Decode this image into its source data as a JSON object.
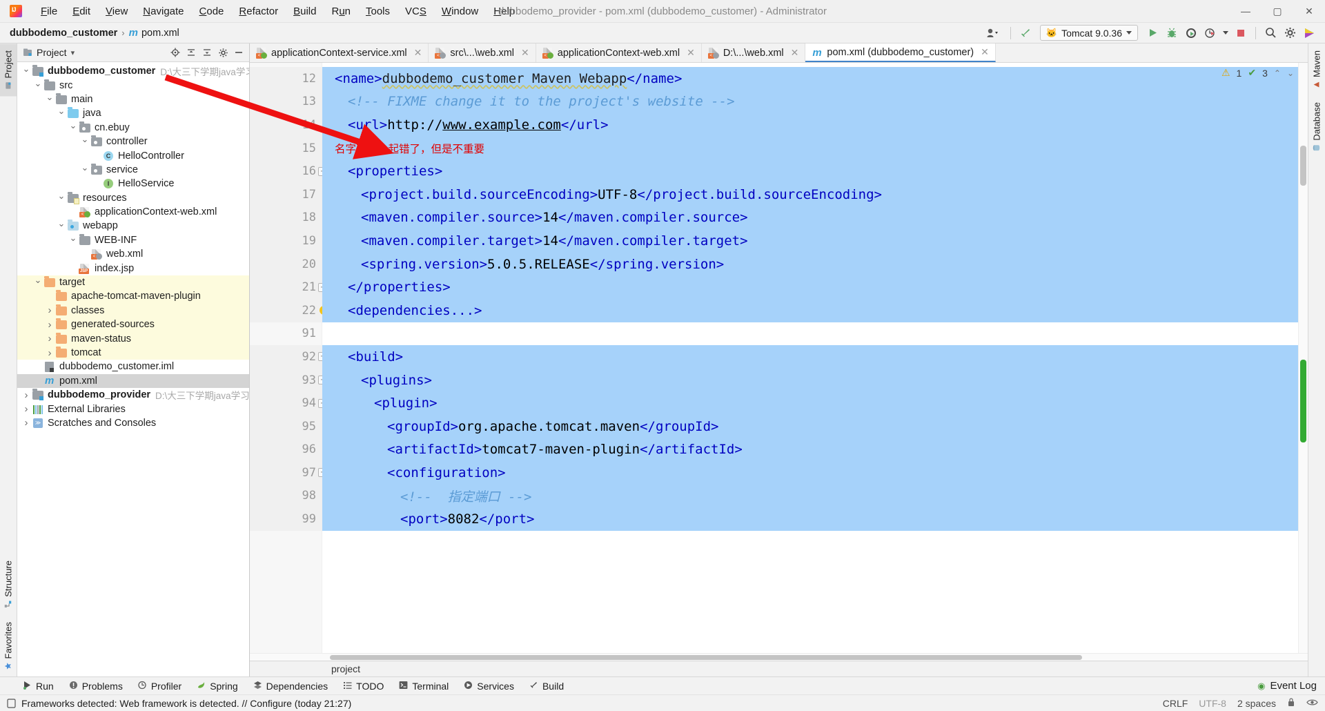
{
  "window": {
    "title": "dubbodemo_provider - pom.xml (dubbodemo_customer) - Administrator",
    "minimize": "—",
    "maximize": "▢",
    "close": "✕"
  },
  "menubar": [
    {
      "label": "File",
      "mnemonic": "F"
    },
    {
      "label": "Edit",
      "mnemonic": "E"
    },
    {
      "label": "View",
      "mnemonic": "V"
    },
    {
      "label": "Navigate",
      "mnemonic": "N"
    },
    {
      "label": "Code",
      "mnemonic": "C"
    },
    {
      "label": "Refactor",
      "mnemonic": "R"
    },
    {
      "label": "Build",
      "mnemonic": "B"
    },
    {
      "label": "Run",
      "mnemonic": "u"
    },
    {
      "label": "Tools",
      "mnemonic": "T"
    },
    {
      "label": "VCS",
      "mnemonic": "S"
    },
    {
      "label": "Window",
      "mnemonic": "W"
    },
    {
      "label": "Help",
      "mnemonic": "H"
    }
  ],
  "navbar": {
    "project": "dubbodemo_customer",
    "separator": "›",
    "file": "pom.xml",
    "file_icon": "m"
  },
  "toolbar": {
    "run_config": "Tomcat 9.0.36",
    "run_config_icon": "tomcat-cat",
    "buttons": [
      {
        "name": "user-settings",
        "glyph": "👤"
      },
      {
        "name": "build-hammer",
        "glyph": "⌃"
      },
      {
        "name": "run",
        "glyph": "▶"
      },
      {
        "name": "debug",
        "glyph": "🐞"
      },
      {
        "name": "run-coverage",
        "glyph": "◗"
      },
      {
        "name": "profiler",
        "glyph": "◷"
      },
      {
        "name": "stop",
        "glyph": "■"
      },
      {
        "name": "search-everywhere",
        "glyph": "🔍"
      },
      {
        "name": "settings-gear",
        "glyph": "⚙"
      },
      {
        "name": "ide-assistant",
        "glyph": "◖"
      }
    ]
  },
  "rails": {
    "left_top": [
      "Project"
    ],
    "left_bottom": [
      "Structure",
      "Favorites"
    ],
    "right": [
      "Maven",
      "Database"
    ]
  },
  "project_panel": {
    "title": "Project",
    "chevron": "▾",
    "actions": [
      "locate-target",
      "expand-all",
      "collapse-all",
      "settings-gear",
      "hide-panel"
    ],
    "tree": [
      {
        "depth": 0,
        "arrow": "down",
        "icon": "module-folder",
        "label": "dubbodemo_customer",
        "bold": true,
        "hint": "D:\\大三下学期java学习\\实训",
        "bg": "none"
      },
      {
        "depth": 1,
        "arrow": "down",
        "icon": "folder-gray",
        "label": "src",
        "bold": false,
        "hint": "",
        "bg": "none"
      },
      {
        "depth": 2,
        "arrow": "down",
        "icon": "folder-gray",
        "label": "main",
        "bold": false,
        "hint": "",
        "bg": "none"
      },
      {
        "depth": 3,
        "arrow": "down",
        "icon": "folder-blue",
        "label": "java",
        "bold": false,
        "hint": "",
        "bg": "none"
      },
      {
        "depth": 4,
        "arrow": "down",
        "icon": "package",
        "label": "cn.ebuy",
        "bold": false,
        "hint": "",
        "bg": "none"
      },
      {
        "depth": 5,
        "arrow": "down",
        "icon": "package",
        "label": "controller",
        "bold": false,
        "hint": "",
        "bg": "none"
      },
      {
        "depth": 6,
        "arrow": "none",
        "icon": "class",
        "label": "HelloController",
        "bold": false,
        "hint": "",
        "bg": "none"
      },
      {
        "depth": 5,
        "arrow": "down",
        "icon": "package",
        "label": "service",
        "bold": false,
        "hint": "",
        "bg": "none"
      },
      {
        "depth": 6,
        "arrow": "none",
        "icon": "interface",
        "label": "HelloService",
        "bold": false,
        "hint": "",
        "bg": "none"
      },
      {
        "depth": 3,
        "arrow": "down",
        "icon": "folder-res",
        "label": "resources",
        "bold": false,
        "hint": "",
        "bg": "none"
      },
      {
        "depth": 4,
        "arrow": "none",
        "icon": "xml-spring",
        "label": "applicationContext-web.xml",
        "bold": false,
        "hint": "",
        "bg": "none"
      },
      {
        "depth": 3,
        "arrow": "down",
        "icon": "folder-web",
        "label": "webapp",
        "bold": false,
        "hint": "",
        "bg": "none"
      },
      {
        "depth": 4,
        "arrow": "down",
        "icon": "folder-gray",
        "label": "WEB-INF",
        "bold": false,
        "hint": "",
        "bg": "none"
      },
      {
        "depth": 5,
        "arrow": "none",
        "icon": "xml-web",
        "label": "web.xml",
        "bold": false,
        "hint": "",
        "bg": "none"
      },
      {
        "depth": 4,
        "arrow": "none",
        "icon": "jsp",
        "label": "index.jsp",
        "bold": false,
        "hint": "",
        "bg": "none"
      },
      {
        "depth": 1,
        "arrow": "down",
        "icon": "folder-orange",
        "label": "target",
        "bold": false,
        "hint": "",
        "bg": "excluded"
      },
      {
        "depth": 2,
        "arrow": "none",
        "icon": "folder-orange",
        "label": "apache-tomcat-maven-plugin",
        "bold": false,
        "hint": "",
        "bg": "excluded"
      },
      {
        "depth": 2,
        "arrow": "right",
        "icon": "folder-orange",
        "label": "classes",
        "bold": false,
        "hint": "",
        "bg": "excluded"
      },
      {
        "depth": 2,
        "arrow": "right",
        "icon": "folder-orange",
        "label": "generated-sources",
        "bold": false,
        "hint": "",
        "bg": "excluded"
      },
      {
        "depth": 2,
        "arrow": "right",
        "icon": "folder-orange",
        "label": "maven-status",
        "bold": false,
        "hint": "",
        "bg": "excluded"
      },
      {
        "depth": 2,
        "arrow": "right",
        "icon": "folder-orange",
        "label": "tomcat",
        "bold": false,
        "hint": "",
        "bg": "excluded"
      },
      {
        "depth": 1,
        "arrow": "none",
        "icon": "iml",
        "label": "dubbodemo_customer.iml",
        "bold": false,
        "hint": "",
        "bg": "none"
      },
      {
        "depth": 1,
        "arrow": "none",
        "icon": "maven-m",
        "label": "pom.xml",
        "bold": false,
        "hint": "",
        "bg": "selected"
      },
      {
        "depth": 0,
        "arrow": "right",
        "icon": "module-folder",
        "label": "dubbodemo_provider",
        "bold": true,
        "hint": "D:\\大三下学期java学习\\实训",
        "bg": "none"
      },
      {
        "depth": 0,
        "arrow": "right",
        "icon": "libraries",
        "label": "External Libraries",
        "bold": false,
        "hint": "",
        "bg": "none"
      },
      {
        "depth": 0,
        "arrow": "right",
        "icon": "scratches",
        "label": "Scratches and Consoles",
        "bold": false,
        "hint": "",
        "bg": "none"
      }
    ]
  },
  "editor_tabs": [
    {
      "label": "applicationContext-service.xml",
      "icon": "xml-spring",
      "active": false,
      "close": "✕"
    },
    {
      "label": "src\\...\\web.xml",
      "icon": "xml-web",
      "active": false,
      "close": "✕"
    },
    {
      "label": "applicationContext-web.xml",
      "icon": "xml-spring",
      "active": false,
      "close": "✕"
    },
    {
      "label": "D:\\...\\web.xml",
      "icon": "xml-web",
      "active": false,
      "close": "✕"
    },
    {
      "label": "pom.xml (dubbodemo_customer)",
      "icon": "maven-m",
      "active": true,
      "close": "✕"
    }
  ],
  "inspections": {
    "warning_count": "1",
    "warning_icon": "⚠",
    "ok_count": "3",
    "ok_icon": "✔",
    "caret_up": "⌃",
    "caret_down": "⌄"
  },
  "editor": {
    "lines": [
      {
        "num": "12",
        "fold": "",
        "selected": true,
        "indent": 0,
        "tokens": [
          {
            "t": "<",
            "c": "tagname"
          },
          {
            "t": "name",
            "c": "tagname"
          },
          {
            "t": ">",
            "c": "tagname"
          },
          {
            "t": "dubbodemo_customer Maven Webapp",
            "c": "wavy"
          },
          {
            "t": "<",
            "c": "tagname"
          },
          {
            "t": "/name",
            "c": "tagname"
          },
          {
            "t": ">",
            "c": "tagname"
          }
        ]
      },
      {
        "num": "13",
        "fold": "",
        "selected": true,
        "indent": 1,
        "tokens": [
          {
            "t": "<!-- FIXME change it to the project's website -->",
            "c": "comment"
          }
        ]
      },
      {
        "num": "14",
        "fold": "",
        "selected": true,
        "indent": 1,
        "tokens": [
          {
            "t": "<url>",
            "c": "tagname"
          },
          {
            "t": "http://",
            "c": "plain"
          },
          {
            "t": "www.example.com",
            "c": "link"
          },
          {
            "t": "</url>",
            "c": "tagname"
          }
        ]
      },
      {
        "num": "15",
        "fold": "",
        "selected": true,
        "indent": 0,
        "annotation": "名字不小心起错了，但是不重要",
        "tokens": []
      },
      {
        "num": "16",
        "fold": "minus",
        "selected": true,
        "indent": 1,
        "tokens": [
          {
            "t": "<properties>",
            "c": "tagname"
          }
        ]
      },
      {
        "num": "17",
        "fold": "",
        "selected": true,
        "indent": 2,
        "tokens": [
          {
            "t": "<project.build.sourceEncoding>",
            "c": "tagname"
          },
          {
            "t": "UTF-8",
            "c": "plain"
          },
          {
            "t": "</project.build.sourceEncoding>",
            "c": "tagname"
          }
        ]
      },
      {
        "num": "18",
        "fold": "",
        "selected": true,
        "indent": 2,
        "tokens": [
          {
            "t": "<maven.compiler.source>",
            "c": "tagname"
          },
          {
            "t": "14",
            "c": "plain"
          },
          {
            "t": "</maven.compiler.source>",
            "c": "tagname"
          }
        ]
      },
      {
        "num": "19",
        "fold": "",
        "selected": true,
        "indent": 2,
        "tokens": [
          {
            "t": "<maven.compiler.target>",
            "c": "tagname"
          },
          {
            "t": "14",
            "c": "plain"
          },
          {
            "t": "</maven.compiler.target>",
            "c": "tagname"
          }
        ]
      },
      {
        "num": "20",
        "fold": "",
        "selected": true,
        "indent": 2,
        "tokens": [
          {
            "t": "<spring.version>",
            "c": "tagname"
          },
          {
            "t": "5.0.5.RELEASE",
            "c": "plain"
          },
          {
            "t": "</spring.version>",
            "c": "tagname"
          }
        ]
      },
      {
        "num": "21",
        "fold": "minus",
        "selected": true,
        "indent": 1,
        "tokens": [
          {
            "t": "</properties>",
            "c": "tagname"
          }
        ]
      },
      {
        "num": "22",
        "fold": "",
        "selected": true,
        "indent": 1,
        "bulb": true,
        "tokens": [
          {
            "t": "<dependencies...>",
            "c": "tagname"
          }
        ]
      },
      {
        "num": "91",
        "fold": "",
        "selected": false,
        "indent": 0,
        "tokens": []
      },
      {
        "num": "92",
        "fold": "minus",
        "selected": true,
        "indent": 1,
        "tokens": [
          {
            "t": "<build>",
            "c": "tagname"
          }
        ]
      },
      {
        "num": "93",
        "fold": "minus",
        "selected": true,
        "indent": 2,
        "tokens": [
          {
            "t": "<plugins>",
            "c": "tagname"
          }
        ]
      },
      {
        "num": "94",
        "fold": "minus",
        "selected": true,
        "indent": 3,
        "tokens": [
          {
            "t": "<plugin>",
            "c": "tagname"
          }
        ]
      },
      {
        "num": "95",
        "fold": "",
        "selected": true,
        "indent": 4,
        "tokens": [
          {
            "t": "<groupId>",
            "c": "tagname"
          },
          {
            "t": "org.apache.tomcat.maven",
            "c": "plain"
          },
          {
            "t": "</groupId>",
            "c": "tagname"
          }
        ]
      },
      {
        "num": "96",
        "fold": "",
        "selected": true,
        "indent": 4,
        "tokens": [
          {
            "t": "<artifactId>",
            "c": "tagname"
          },
          {
            "t": "tomcat7-maven-plugin",
            "c": "plain"
          },
          {
            "t": "</artifactId>",
            "c": "tagname"
          }
        ]
      },
      {
        "num": "97",
        "fold": "minus",
        "selected": true,
        "indent": 4,
        "tokens": [
          {
            "t": "<configuration>",
            "c": "tagname"
          }
        ]
      },
      {
        "num": "98",
        "fold": "",
        "selected": true,
        "indent": 5,
        "tokens": [
          {
            "t": "<!--  指定端口 -->",
            "c": "comment"
          }
        ]
      },
      {
        "num": "99",
        "fold": "",
        "selected": true,
        "indent": 5,
        "tokens": [
          {
            "t": "<port>",
            "c": "tagname"
          },
          {
            "t": "8082",
            "c": "plain"
          },
          {
            "t": "</port>",
            "c": "tagname"
          }
        ]
      }
    ],
    "breadcrumb": "project"
  },
  "tool_windows": [
    {
      "label": "Run",
      "icon": "run-icon"
    },
    {
      "label": "Problems",
      "icon": "problems-icon"
    },
    {
      "label": "Profiler",
      "icon": "profiler-icon"
    },
    {
      "label": "Spring",
      "icon": "spring-icon"
    },
    {
      "label": "Dependencies",
      "icon": "dependencies-icon"
    },
    {
      "label": "TODO",
      "icon": "todo-icon"
    },
    {
      "label": "Terminal",
      "icon": "terminal-icon"
    },
    {
      "label": "Services",
      "icon": "services-icon"
    },
    {
      "label": "Build",
      "icon": "build-icon"
    }
  ],
  "event_log": {
    "label": "Event Log",
    "icon": "event-log-icon"
  },
  "statusbar": {
    "message": "Frameworks detected: Web framework is detected. // Configure (today 21:27)",
    "message_icon": "notification-icon",
    "line_separator": "CRLF",
    "encoding": "UTF-8",
    "indent": "2 spaces",
    "lock_icon": "🔒",
    "inspection_icon": "👁"
  },
  "colors": {
    "selection_blue": "#a6d2fa",
    "excluded_yellow": "#fdfbdd",
    "tree_selected_gray": "#d4d4d4",
    "tag_blue": "#0000c0",
    "comment_blue": "#5b9bd5",
    "annotation_red": "#e00000",
    "accent_tab": "#4083c9"
  }
}
